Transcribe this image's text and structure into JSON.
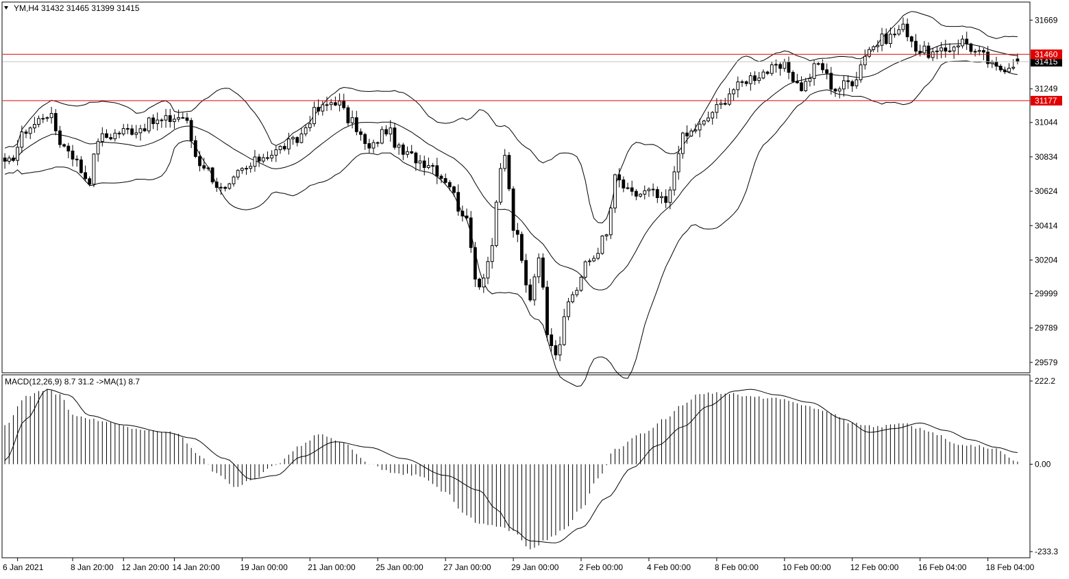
{
  "header": {
    "symbol_label": "YM,H4  31432 31465 31399 31415",
    "menu_icon": "triangle-down-icon"
  },
  "macd_header": {
    "label": "MACD(12,26,9) 8.7 31.2  ->MA(1) 8.7"
  },
  "price_axis": {
    "ticks": [
      "31669",
      "31249",
      "31044",
      "30834",
      "30624",
      "30414",
      "30204",
      "29999",
      "29789",
      "29579"
    ],
    "ticks_values": [
      31669,
      31249,
      31044,
      30834,
      30624,
      30414,
      30204,
      29999,
      29789,
      29579
    ],
    "ymin": 29520,
    "ymax": 31775
  },
  "macd_axis": {
    "ticks": [
      "222.2",
      "0.00",
      "-233.3"
    ],
    "ticks_values": [
      222.2,
      0,
      -233.3
    ],
    "ymin": -233.3,
    "ymax": 222.2
  },
  "time_axis": {
    "labels": [
      "6 Jan 2021",
      "8 Jan 20:00",
      "12 Jan 20:00",
      "14 Jan 20:00",
      "19 Jan 00:00",
      "21 Jan 00:00",
      "25 Jan 00:00",
      "27 Jan 00:00",
      "29 Jan 00:00",
      "2 Feb 00:00",
      "4 Feb 00:00",
      "8 Feb 00:00",
      "10 Feb 00:00",
      "12 Feb 00:00",
      "16 Feb 04:00",
      "18 Feb 04:00"
    ],
    "label_bar_index": [
      3,
      16,
      28,
      40,
      56,
      72,
      88,
      104,
      120,
      136,
      152,
      168,
      184,
      200,
      216,
      232
    ]
  },
  "horizontal_lines": [
    {
      "name": "resistance-line",
      "value": 31460,
      "label": "31460",
      "color": "#e00000"
    },
    {
      "name": "support-line",
      "value": 31177,
      "label": "31177",
      "color": "#e00000"
    }
  ],
  "bid_line": {
    "value": 31415,
    "label": "31415",
    "color": "#c0c0c0"
  },
  "colors": {
    "bull_body": "#ffffff",
    "bear_body": "#000000",
    "outline": "#000000",
    "band": "#000000",
    "level_line": "#e00000",
    "label_bg_red": "#e00000",
    "label_bg_dark": "#000000",
    "signal_line": "#000000",
    "macd_histogram": "#000000"
  },
  "chart_data": [
    {
      "type": "candlestick",
      "title": "YM,H4",
      "bars_visible": 240,
      "indicators": [
        "Bollinger Bands (upper, middle, lower)"
      ],
      "anchors_close": [
        [
          0,
          30780
        ],
        [
          6,
          31020
        ],
        [
          10,
          31100
        ],
        [
          14,
          30900
        ],
        [
          20,
          30700
        ],
        [
          22,
          30950
        ],
        [
          30,
          31000
        ],
        [
          36,
          31050
        ],
        [
          42,
          31080
        ],
        [
          46,
          30800
        ],
        [
          52,
          30620
        ],
        [
          56,
          30750
        ],
        [
          62,
          30850
        ],
        [
          68,
          30920
        ],
        [
          74,
          31120
        ],
        [
          78,
          31180
        ],
        [
          82,
          31040
        ],
        [
          86,
          30880
        ],
        [
          90,
          31000
        ],
        [
          94,
          30850
        ],
        [
          100,
          30800
        ],
        [
          104,
          30700
        ],
        [
          108,
          30500
        ],
        [
          112,
          30050
        ],
        [
          114,
          30200
        ],
        [
          118,
          30850
        ],
        [
          120,
          30400
        ],
        [
          124,
          29980
        ],
        [
          126,
          30250
        ],
        [
          128,
          29780
        ],
        [
          130,
          29650
        ],
        [
          134,
          30000
        ],
        [
          138,
          30200
        ],
        [
          142,
          30350
        ],
        [
          144,
          30700
        ],
        [
          148,
          30600
        ],
        [
          152,
          30620
        ],
        [
          156,
          30550
        ],
        [
          160,
          30950
        ],
        [
          164,
          31020
        ],
        [
          168,
          31130
        ],
        [
          172,
          31250
        ],
        [
          176,
          31320
        ],
        [
          180,
          31360
        ],
        [
          184,
          31380
        ],
        [
          188,
          31260
        ],
        [
          192,
          31400
        ],
        [
          196,
          31250
        ],
        [
          200,
          31300
        ],
        [
          204,
          31500
        ],
        [
          208,
          31560
        ],
        [
          212,
          31620
        ],
        [
          216,
          31480
        ],
        [
          220,
          31460
        ],
        [
          226,
          31540
        ],
        [
          230,
          31460
        ],
        [
          234,
          31370
        ],
        [
          239,
          31415
        ]
      ],
      "last_candle": {
        "open": 31432,
        "high": 31465,
        "low": 31399,
        "close": 31415
      }
    },
    {
      "type": "bar",
      "title": "MACD(12,26,9)",
      "series": [
        {
          "name": "MACD",
          "value": 8.7
        },
        {
          "name": "MA(1)",
          "value": 31.2
        }
      ],
      "histogram_anchors": [
        [
          0,
          105
        ],
        [
          5,
          180
        ],
        [
          10,
          200
        ],
        [
          13,
          185
        ],
        [
          16,
          130
        ],
        [
          24,
          115
        ],
        [
          30,
          95
        ],
        [
          40,
          85
        ],
        [
          46,
          25
        ],
        [
          50,
          -25
        ],
        [
          54,
          -60
        ],
        [
          58,
          -45
        ],
        [
          64,
          0
        ],
        [
          70,
          50
        ],
        [
          74,
          80
        ],
        [
          80,
          55
        ],
        [
          86,
          0
        ],
        [
          92,
          -25
        ],
        [
          98,
          -30
        ],
        [
          104,
          -75
        ],
        [
          108,
          -130
        ],
        [
          112,
          -160
        ],
        [
          116,
          -165
        ],
        [
          120,
          -180
        ],
        [
          124,
          -230
        ],
        [
          128,
          -200
        ],
        [
          132,
          -175
        ],
        [
          136,
          -120
        ],
        [
          140,
          -40
        ],
        [
          144,
          40
        ],
        [
          150,
          80
        ],
        [
          156,
          120
        ],
        [
          160,
          160
        ],
        [
          164,
          190
        ],
        [
          170,
          190
        ],
        [
          176,
          180
        ],
        [
          182,
          175
        ],
        [
          188,
          160
        ],
        [
          194,
          140
        ],
        [
          200,
          110
        ],
        [
          206,
          100
        ],
        [
          212,
          110
        ],
        [
          216,
          95
        ],
        [
          220,
          80
        ],
        [
          224,
          55
        ],
        [
          230,
          48
        ],
        [
          234,
          40
        ],
        [
          239,
          9
        ]
      ],
      "signal_anchors": [
        [
          0,
          10
        ],
        [
          5,
          120
        ],
        [
          10,
          200
        ],
        [
          15,
          185
        ],
        [
          20,
          130
        ],
        [
          28,
          105
        ],
        [
          38,
          85
        ],
        [
          44,
          70
        ],
        [
          52,
          15
        ],
        [
          58,
          -40
        ],
        [
          64,
          -30
        ],
        [
          70,
          20
        ],
        [
          78,
          60
        ],
        [
          86,
          45
        ],
        [
          94,
          15
        ],
        [
          104,
          -30
        ],
        [
          112,
          -70
        ],
        [
          116,
          -120
        ],
        [
          120,
          -175
        ],
        [
          124,
          -205
        ],
        [
          130,
          -210
        ],
        [
          136,
          -170
        ],
        [
          142,
          -90
        ],
        [
          148,
          -10
        ],
        [
          154,
          50
        ],
        [
          160,
          100
        ],
        [
          166,
          155
        ],
        [
          172,
          195
        ],
        [
          176,
          200
        ],
        [
          182,
          185
        ],
        [
          190,
          165
        ],
        [
          198,
          120
        ],
        [
          204,
          85
        ],
        [
          210,
          95
        ],
        [
          216,
          110
        ],
        [
          222,
          90
        ],
        [
          228,
          65
        ],
        [
          234,
          45
        ],
        [
          239,
          31
        ]
      ]
    }
  ]
}
